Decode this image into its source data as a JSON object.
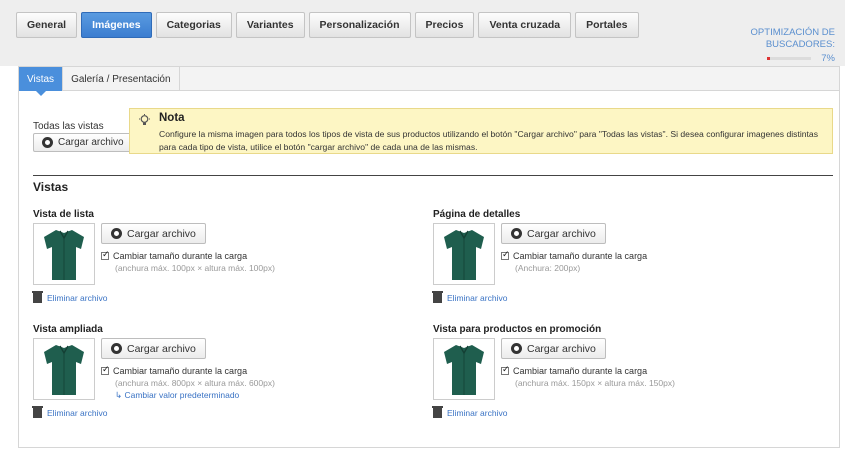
{
  "tabs": [
    {
      "label": "General",
      "active": false
    },
    {
      "label": "Imágenes",
      "active": true
    },
    {
      "label": "Categorias",
      "active": false
    },
    {
      "label": "Variantes",
      "active": false
    },
    {
      "label": "Personalización",
      "active": false
    },
    {
      "label": "Precios",
      "active": false
    },
    {
      "label": "Venta cruzada",
      "active": false
    },
    {
      "label": "Portales",
      "active": false
    }
  ],
  "seo": {
    "title": "OPTIMIZACIÓN DE BUSCADORES:",
    "percent": "7%",
    "progress": 0.07
  },
  "subtabs": [
    {
      "label": "Vistas",
      "active": true
    },
    {
      "label": "Galería / Presentación",
      "active": false
    }
  ],
  "all_views": {
    "label": "Todas las vistas",
    "button": "Cargar archivo"
  },
  "note": {
    "title": "Nota",
    "text": "Configure la misma imagen para todos los tipos de vista de sus productos utilizando el botón \"Cargar archivo\" para \"Todas las vistas\". Si desea configurar imagenes distintas para cada tipo de vista, utilice el botón \"cargar archivo\" de cada una de las mismas."
  },
  "section_title": "Vistas",
  "views": {
    "list": {
      "title": "Vista de lista",
      "button": "Cargar archivo",
      "checkbox": "Cambiar tamaño durante la carga",
      "hint": "(anchura máx. 100px × altura máx. 100px)",
      "delete": "Eliminar archivo"
    },
    "details": {
      "title": "Página de detalles",
      "button": "Cargar archivo",
      "checkbox": "Cambiar tamaño durante la carga",
      "hint": "(Anchura: 200px)",
      "delete": "Eliminar archivo"
    },
    "zoom": {
      "title": "Vista ampliada",
      "button": "Cargar archivo",
      "checkbox": "Cambiar tamaño durante la carga",
      "hint": "(anchura máx. 800px × altura máx. 600px)",
      "reset": "↳ Cambiar valor predeterminado",
      "delete": "Eliminar archivo"
    },
    "promo": {
      "title": "Vista para productos en promoción",
      "button": "Cargar archivo",
      "checkbox": "Cambiar tamaño durante la carga",
      "hint": "(anchura máx. 150px × altura máx. 150px)",
      "delete": "Eliminar archivo"
    }
  },
  "colors": {
    "accent": "#4a8fdc",
    "note_bg": "#fdf6c4",
    "link": "#3a73c4",
    "shirt": "#1f5e4e"
  }
}
